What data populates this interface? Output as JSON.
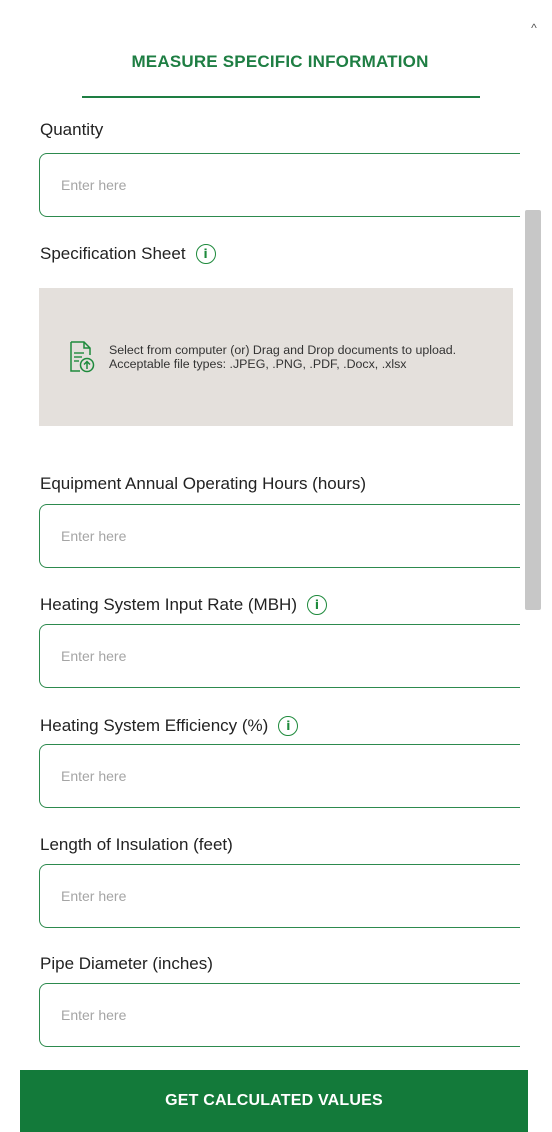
{
  "header": {
    "title": "MEASURE SPECIFIC INFORMATION"
  },
  "fields": {
    "quantity": {
      "label": "Quantity",
      "placeholder": "Enter here",
      "value": ""
    },
    "specification_sheet": {
      "label": "Specification Sheet",
      "upload_text": "Select from computer (or) Drag and Drop documents to upload. Acceptable file types: .JPEG, .PNG, .PDF, .Docx, .xlsx"
    },
    "operating_hours": {
      "label": "Equipment Annual Operating Hours (hours)",
      "placeholder": "Enter here",
      "value": ""
    },
    "input_rate": {
      "label": "Heating System Input Rate (MBH)",
      "placeholder": "Enter here",
      "value": ""
    },
    "efficiency": {
      "label": "Heating System Efficiency (%)",
      "placeholder": "Enter here",
      "value": ""
    },
    "insulation_length": {
      "label": "Length of Insulation (feet)",
      "placeholder": "Enter here",
      "value": ""
    },
    "pipe_diameter": {
      "label": "Pipe Diameter (inches)",
      "placeholder": "Enter here",
      "value": ""
    }
  },
  "icons": {
    "info_glyph": "i",
    "scroll_up_glyph": "^"
  },
  "footer": {
    "button_label": "GET CALCULATED VALUES"
  },
  "colors": {
    "accent": "#1e7e43",
    "button": "#137a3a",
    "upload_bg": "#e4e0dc"
  }
}
